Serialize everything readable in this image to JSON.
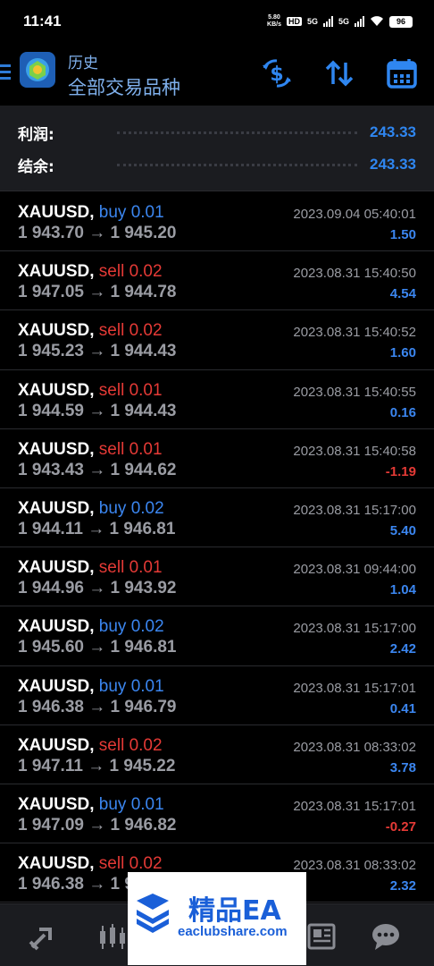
{
  "status": {
    "time": "11:41",
    "net_speed_value": "5.80",
    "net_speed_unit": "KB/s",
    "hd_badge": "HD",
    "signal_1": "5G",
    "signal_2": "5G",
    "battery": "96"
  },
  "header": {
    "title": "历史",
    "subtitle": "全部交易品种"
  },
  "summary": {
    "profit_label": "利润:",
    "profit_value": "243.33",
    "balance_label": "结余:",
    "balance_value": "243.33"
  },
  "trades": [
    {
      "symbol": "XAUUSD,",
      "side": "buy",
      "volume": "buy 0.01",
      "prices": "1 943.70 → 1 945.20",
      "time": "2023.09.04 05:40:01",
      "profit": "1.50"
    },
    {
      "symbol": "XAUUSD,",
      "side": "sell",
      "volume": "sell 0.02",
      "prices": "1 947.05 → 1 944.78",
      "time": "2023.08.31 15:40:50",
      "profit": "4.54"
    },
    {
      "symbol": "XAUUSD,",
      "side": "sell",
      "volume": "sell 0.02",
      "prices": "1 945.23 → 1 944.43",
      "time": "2023.08.31 15:40:52",
      "profit": "1.60"
    },
    {
      "symbol": "XAUUSD,",
      "side": "sell",
      "volume": "sell 0.01",
      "prices": "1 944.59 → 1 944.43",
      "time": "2023.08.31 15:40:55",
      "profit": "0.16"
    },
    {
      "symbol": "XAUUSD,",
      "side": "sell",
      "volume": "sell 0.01",
      "prices": "1 943.43 → 1 944.62",
      "time": "2023.08.31 15:40:58",
      "profit": "-1.19"
    },
    {
      "symbol": "XAUUSD,",
      "side": "buy",
      "volume": "buy 0.02",
      "prices": "1 944.11 → 1 946.81",
      "time": "2023.08.31 15:17:00",
      "profit": "5.40"
    },
    {
      "symbol": "XAUUSD,",
      "side": "sell",
      "volume": "sell 0.01",
      "prices": "1 944.96 → 1 943.92",
      "time": "2023.08.31 09:44:00",
      "profit": "1.04"
    },
    {
      "symbol": "XAUUSD,",
      "side": "buy",
      "volume": "buy 0.02",
      "prices": "1 945.60 → 1 946.81",
      "time": "2023.08.31 15:17:00",
      "profit": "2.42"
    },
    {
      "symbol": "XAUUSD,",
      "side": "buy",
      "volume": "buy 0.01",
      "prices": "1 946.38 → 1 946.79",
      "time": "2023.08.31 15:17:01",
      "profit": "0.41"
    },
    {
      "symbol": "XAUUSD,",
      "side": "sell",
      "volume": "sell 0.02",
      "prices": "1 947.11 → 1 945.22",
      "time": "2023.08.31 08:33:02",
      "profit": "3.78"
    },
    {
      "symbol": "XAUUSD,",
      "side": "buy",
      "volume": "buy 0.01",
      "prices": "1 947.09 → 1 946.82",
      "time": "2023.08.31 15:17:01",
      "profit": "-0.27"
    },
    {
      "symbol": "XAUUSD,",
      "side": "sell",
      "volume": "sell 0.02",
      "prices": "1 946.38 → 1 9",
      "time": "2023.08.31 08:33:02",
      "profit": "2.32"
    }
  ],
  "watermark": {
    "title": "精品EA",
    "url": "eaclubshare.com"
  },
  "colors": {
    "accent": "#2f86f0",
    "buy": "#3b86f0",
    "sell": "#e53a36"
  },
  "icons": {
    "header": [
      "currency-exchange-icon",
      "sort-icon",
      "calendar-icon"
    ],
    "nav": [
      "trade-icon",
      "chart-icon",
      "news-icon",
      "chat-icon"
    ]
  }
}
